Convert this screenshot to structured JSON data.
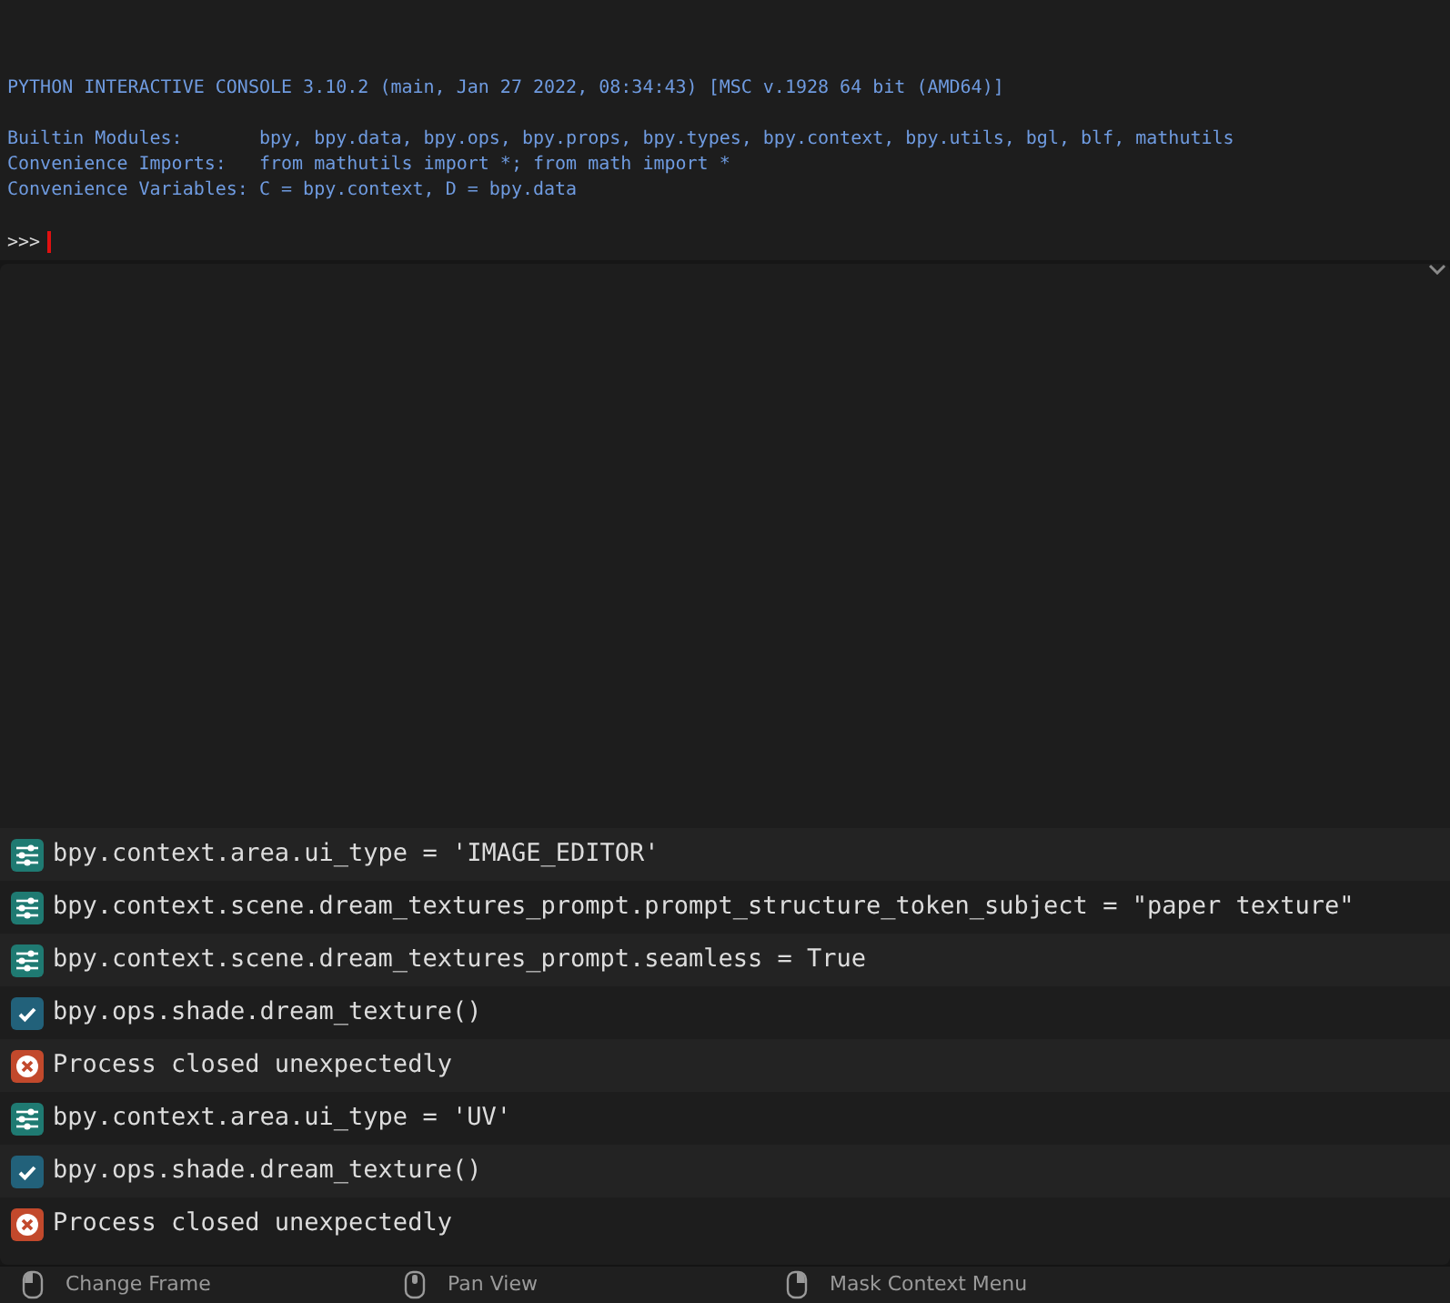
{
  "console": {
    "lines": [
      {
        "kind": "output",
        "text": "PYTHON INTERACTIVE CONSOLE 3.10.2 (main, Jan 27 2022, 08:34:43) [MSC v.1928 64 bit (AMD64)]"
      },
      {
        "kind": "blank"
      },
      {
        "kind": "output",
        "text": "Builtin Modules:       bpy, bpy.data, bpy.ops, bpy.props, bpy.types, bpy.context, bpy.utils, bgl, blf, mathutils"
      },
      {
        "kind": "output",
        "text": "Convenience Imports:   from mathutils import *; from math import *"
      },
      {
        "kind": "output",
        "text": "Convenience Variables: C = bpy.context, D = bpy.data"
      },
      {
        "kind": "blank"
      }
    ],
    "prompt": ">>>"
  },
  "info_log": [
    {
      "kind": "property",
      "text": "bpy.context.area.ui_type = 'IMAGE_EDITOR'"
    },
    {
      "kind": "property",
      "text": "bpy.context.scene.dream_textures_prompt.prompt_structure_token_subject = \"paper texture\""
    },
    {
      "kind": "property",
      "text": "bpy.context.scene.dream_textures_prompt.seamless = True"
    },
    {
      "kind": "operator",
      "text": "bpy.ops.shade.dream_texture()"
    },
    {
      "kind": "error",
      "text": "Process closed unexpectedly"
    },
    {
      "kind": "property",
      "text": "bpy.context.area.ui_type = 'UV'"
    },
    {
      "kind": "operator",
      "text": "bpy.ops.shade.dream_texture()"
    },
    {
      "kind": "error",
      "text": "Process closed unexpectedly"
    }
  ],
  "status_bar": [
    {
      "kind": "left",
      "label": "Change Frame"
    },
    {
      "kind": "middle",
      "label": "Pan View"
    },
    {
      "kind": "right",
      "label": "Mask Context Menu"
    }
  ]
}
